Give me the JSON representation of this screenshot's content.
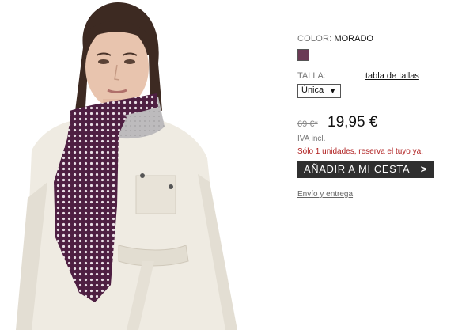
{
  "product": {
    "image_alt": "model-wearing-scarf"
  },
  "options": {
    "color_label": "COLOR:",
    "color_value": "MORADO",
    "swatch_color": "#6b3a55",
    "size_label": "TALLA:",
    "size_guide_link": "tabla de tallas",
    "size_selected": "Única"
  },
  "pricing": {
    "old_price": "69 €*",
    "new_price": "19,95 €",
    "tax_note": "IVA incl.",
    "stock_note": "Sólo 1 unidades, reserva el tuyo ya."
  },
  "actions": {
    "add_to_cart_label": "AÑADIR A MI CESTA",
    "add_to_cart_arrow": ">",
    "shipping_link": "Envío y entrega"
  },
  "colors": {
    "scarf_purple": "#5a2a4a",
    "scarf_grey": "#b8b6b8",
    "coat": "#efebe2",
    "hair": "#3d2a22",
    "skin": "#e8c4ae"
  }
}
